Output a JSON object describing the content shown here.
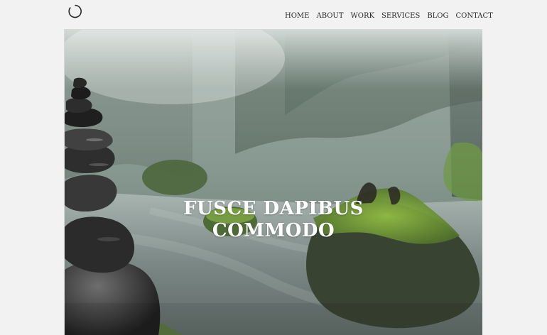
{
  "header": {
    "logo_icon": "ring-logo-icon",
    "nav": [
      {
        "label": "HOME"
      },
      {
        "label": "ABOUT"
      },
      {
        "label": "WORK"
      },
      {
        "label": "SERVICES"
      },
      {
        "label": "BLOG"
      },
      {
        "label": "CONTACT"
      }
    ]
  },
  "hero": {
    "title_line1": "FUSCE DAPIBUS",
    "title_line2": "COMMODO",
    "image_icon": "misty-forest-stream-photo",
    "colors": {
      "sky_fog": "#c9d3cf",
      "forest": "#5f6f67",
      "water": "#6f7b77",
      "moss": "#7fa43a",
      "stone": "#2a2a2a"
    }
  }
}
